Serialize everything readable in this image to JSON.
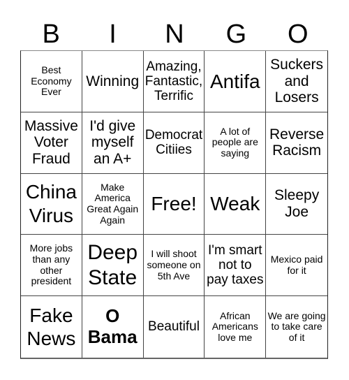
{
  "header": {
    "letters": [
      "B",
      "I",
      "N",
      "G",
      "O"
    ]
  },
  "cells": [
    "Best Economy Ever",
    "Winning",
    "Amazing, Fantastic, Terrific",
    "Antifa",
    "Suckers and Losers",
    "Massive Voter Fraud",
    "I'd give myself an A+",
    "Democrat Citiies",
    "A lot of people are saying",
    "Reverse Racism",
    "China Virus",
    "Make America Great Again Again",
    "Free!",
    "Weak",
    "Sleepy Joe",
    "More jobs than any other president",
    "Deep State",
    "I will shoot someone on 5th Ave",
    "I'm smart not to pay taxes",
    "Mexico paid for it",
    "Fake News",
    "O Bama",
    "Beautiful",
    "African Americans love me",
    "We are going to take care of it"
  ]
}
